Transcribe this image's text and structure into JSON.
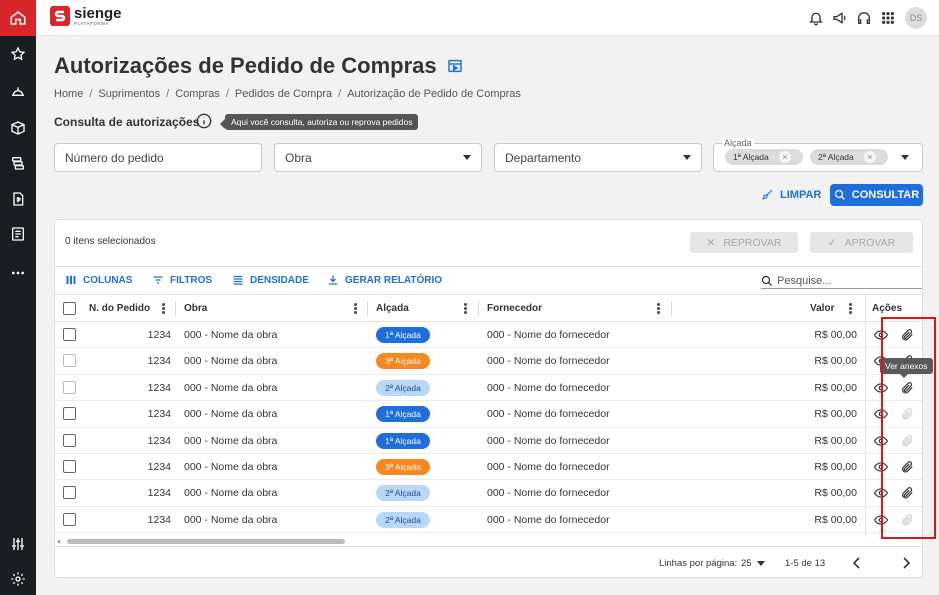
{
  "brand": {
    "name": "sienge",
    "sub": "PLATAFORMA",
    "accent": "#d9262b",
    "primary": "#1e6fd9"
  },
  "topbar": {
    "avatar": "DS",
    "icons": [
      "bell-icon",
      "megaphone-icon",
      "headset-icon",
      "apps-grid-icon"
    ]
  },
  "sidebar": {
    "icons": [
      "home-icon",
      "star-icon",
      "helmet-icon",
      "box-icon",
      "coins-icon",
      "document-dollar-icon",
      "report-icon",
      "more-icon",
      "sliders-icon",
      "settings-icon"
    ]
  },
  "page": {
    "title": "Autorizações de Pedido de Compras",
    "breadcrumb": [
      "Home",
      "Suprimentos",
      "Compras",
      "Pedidos de Compra",
      "Autorização de Pedido de Compras"
    ],
    "section_title": "Consulta de autorizações",
    "help_tip": "Aqui você consulta, autoriza ou reprova pedidos"
  },
  "filters": {
    "pedido_placeholder": "Número do pedido",
    "obra": "Obra",
    "departamento": "Departamento",
    "alcada_label": "Alçada",
    "alcada_chips": [
      "1ª Alçada",
      "2ª Alçada"
    ],
    "limpar": "LIMPAR",
    "consultar": "CONSULTAR"
  },
  "table": {
    "selected_text": "0 itens selecionados",
    "reprovar": "REPROVAR",
    "aprovar": "APROVAR",
    "toolbar": {
      "colunas": "COLUNAS",
      "filtros": "FILTROS",
      "densidade": "DENSIDADE",
      "relatorio": "GERAR RELATÓRIO"
    },
    "search_placeholder": "Pesquise...",
    "columns": {
      "pedido": "N. do Pedido",
      "obra": "Obra",
      "alcada": "Alçada",
      "fornecedor": "Fornecedor",
      "valor": "Valor",
      "acoes": "Ações"
    },
    "rows": [
      {
        "pedido": "1234",
        "obra": "000 - Nome da obra",
        "alcada": "1ª Alçada",
        "level": 1,
        "fornecedor": "000 - Nome do fornecedor",
        "valor": "R$ 00,00",
        "anexo": true,
        "cb_dim": false
      },
      {
        "pedido": "1234",
        "obra": "000 - Nome da obra",
        "alcada": "3ª Alçada",
        "level": 3,
        "fornecedor": "000 - Nome do fornecedor",
        "valor": "R$ 00,00",
        "anexo": true,
        "cb_dim": true
      },
      {
        "pedido": "1234",
        "obra": "000 - Nome da obra",
        "alcada": "2ª Alçada",
        "level": 2,
        "fornecedor": "000 - Nome do fornecedor",
        "valor": "R$ 00,00",
        "anexo": true,
        "cb_dim": true
      },
      {
        "pedido": "1234",
        "obra": "000 - Nome da obra",
        "alcada": "1ª Alçada",
        "level": 1,
        "fornecedor": "000 - Nome do fornecedor",
        "valor": "R$ 00,00",
        "anexo": false,
        "cb_dim": false
      },
      {
        "pedido": "1234",
        "obra": "000 - Nome da obra",
        "alcada": "1ª Alçada",
        "level": 1,
        "fornecedor": "000 - Nome do fornecedor",
        "valor": "R$ 00,00",
        "anexo": false,
        "cb_dim": false
      },
      {
        "pedido": "1234",
        "obra": "000 - Nome da obra",
        "alcada": "3ª Alçada",
        "level": 3,
        "fornecedor": "000 - Nome do fornecedor",
        "valor": "R$ 00,00",
        "anexo": true,
        "cb_dim": false
      },
      {
        "pedido": "1234",
        "obra": "000 - Nome da obra",
        "alcada": "2ª Alçada",
        "level": 2,
        "fornecedor": "000 - Nome do fornecedor",
        "valor": "R$ 00,00",
        "anexo": true,
        "cb_dim": false
      },
      {
        "pedido": "1234",
        "obra": "000 - Nome da obra",
        "alcada": "2ª Alçada",
        "level": 2,
        "fornecedor": "000 - Nome do fornecedor",
        "valor": "R$ 00,00",
        "anexo": false,
        "cb_dim": false
      }
    ],
    "badge_colors": {
      "1": {
        "bg": "#1e6fd9",
        "fg": "#ffffff"
      },
      "2": {
        "bg": "#b9d7f7",
        "fg": "#1e4f96"
      },
      "3": {
        "bg": "#f5891f",
        "fg": "#ffffff"
      }
    },
    "ver_anexos": "Ver anexos",
    "footer": {
      "rows_label": "Linhas por página:",
      "rows_value": "25",
      "range": "1-5 de 13"
    }
  }
}
